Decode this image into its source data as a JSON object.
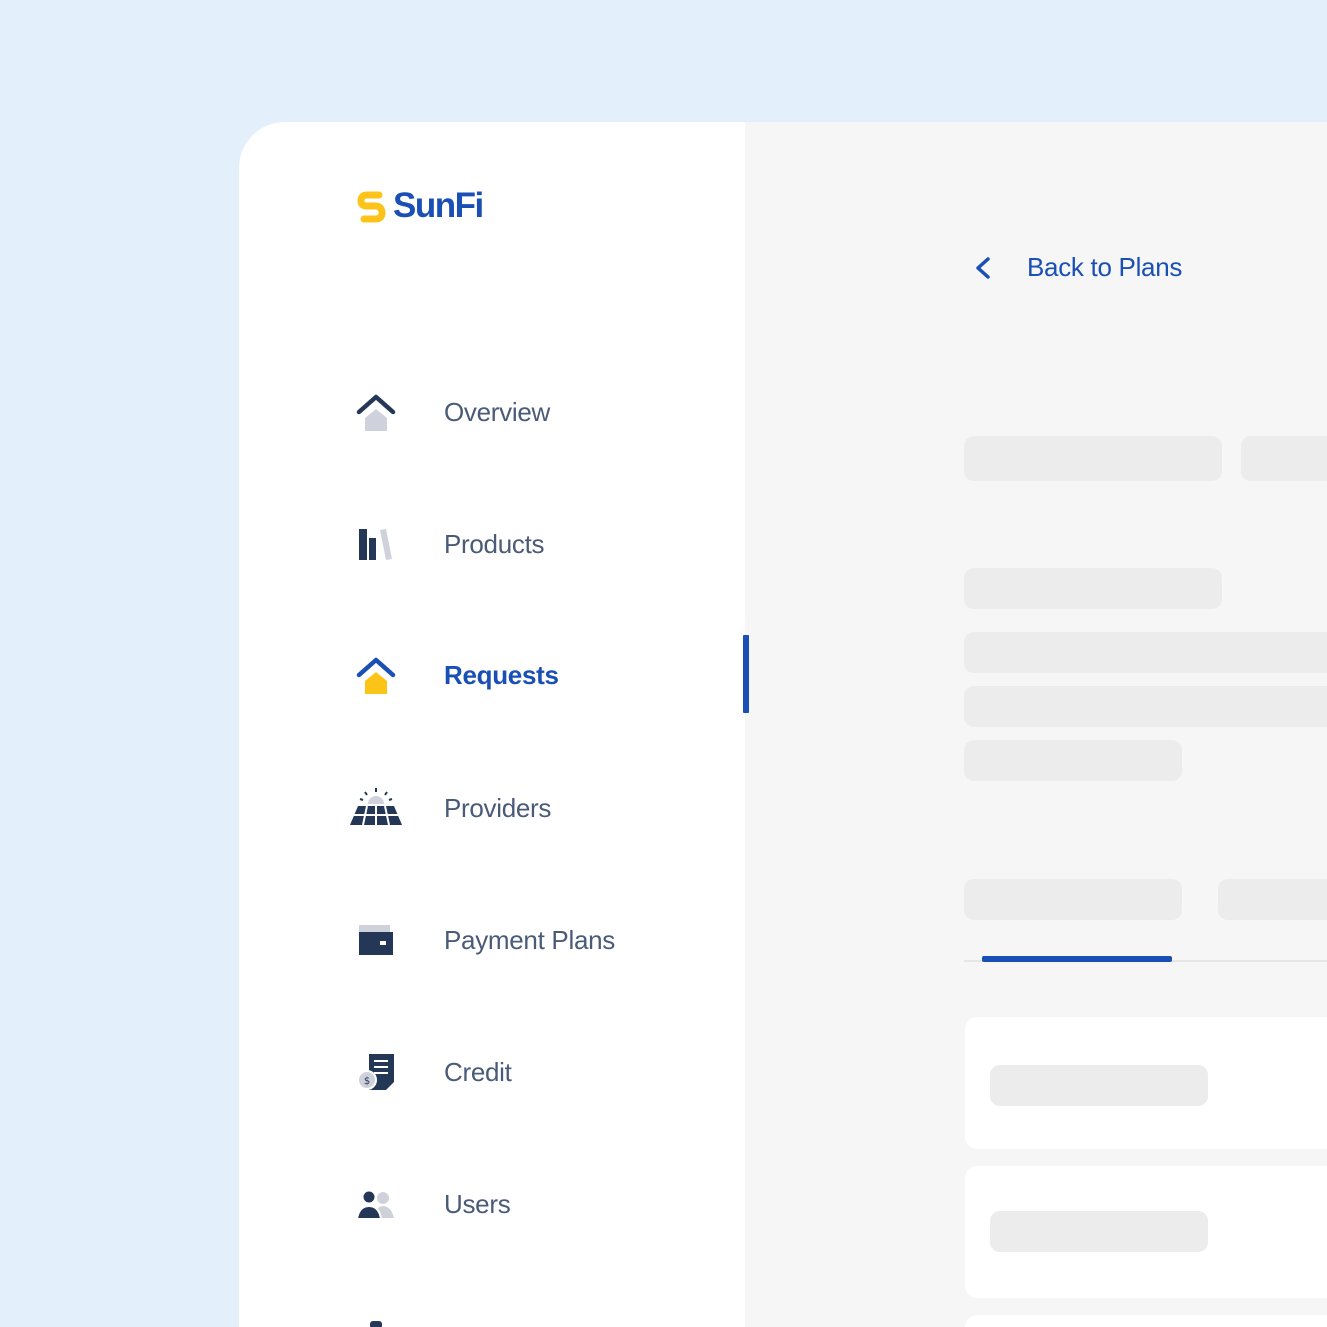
{
  "brand": {
    "name": "SunFi",
    "logo_icon": "sunfi-s-icon",
    "colors": {
      "primary": "#1a4fb5",
      "accent": "#fcc419",
      "muted": "#4a5b78"
    }
  },
  "sidebar": {
    "items": [
      {
        "label": "Overview",
        "icon": "house-icon",
        "active": false
      },
      {
        "label": "Products",
        "icon": "products-bars-icon",
        "active": false
      },
      {
        "label": "Requests",
        "icon": "house-icon",
        "active": true
      },
      {
        "label": "Providers",
        "icon": "solar-panel-icon",
        "active": false
      },
      {
        "label": "Payment Plans",
        "icon": "wallet-icon",
        "active": false
      },
      {
        "label": "Credit",
        "icon": "credit-document-icon",
        "active": false
      },
      {
        "label": "Users",
        "icon": "users-icon",
        "active": false
      }
    ]
  },
  "main": {
    "back_link": {
      "label": "Back to Plans",
      "icon": "chevron-left-icon"
    },
    "loading": true
  }
}
